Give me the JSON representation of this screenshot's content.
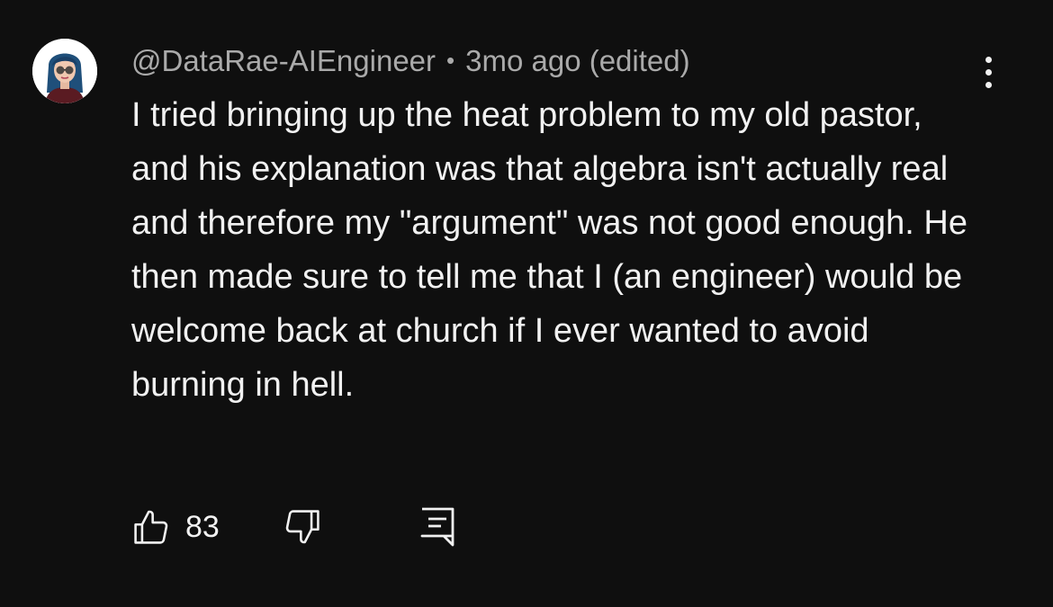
{
  "comment": {
    "author": "@DataRae-AIEngineer",
    "separator": "•",
    "timestamp": "3mo ago (edited)",
    "text": "I tried bringing up the heat problem to my old pastor, and his explanation was that algebra isn't actually real and therefore my \"argument\" was not good enough. He then made sure to tell me that I (an engineer) would be welcome back at church if I ever wanted to avoid burning in hell.",
    "like_count": "83"
  },
  "icons": {
    "avatar": "cartoon-avatar",
    "more": "vertical-ellipsis-icon",
    "like": "thumbs-up-icon",
    "dislike": "thumbs-down-icon",
    "reply": "reply-comment-icon"
  },
  "colors": {
    "background": "#0f0f0f",
    "primary_text": "#f1f1f1",
    "secondary_text": "#aaaaaa"
  }
}
